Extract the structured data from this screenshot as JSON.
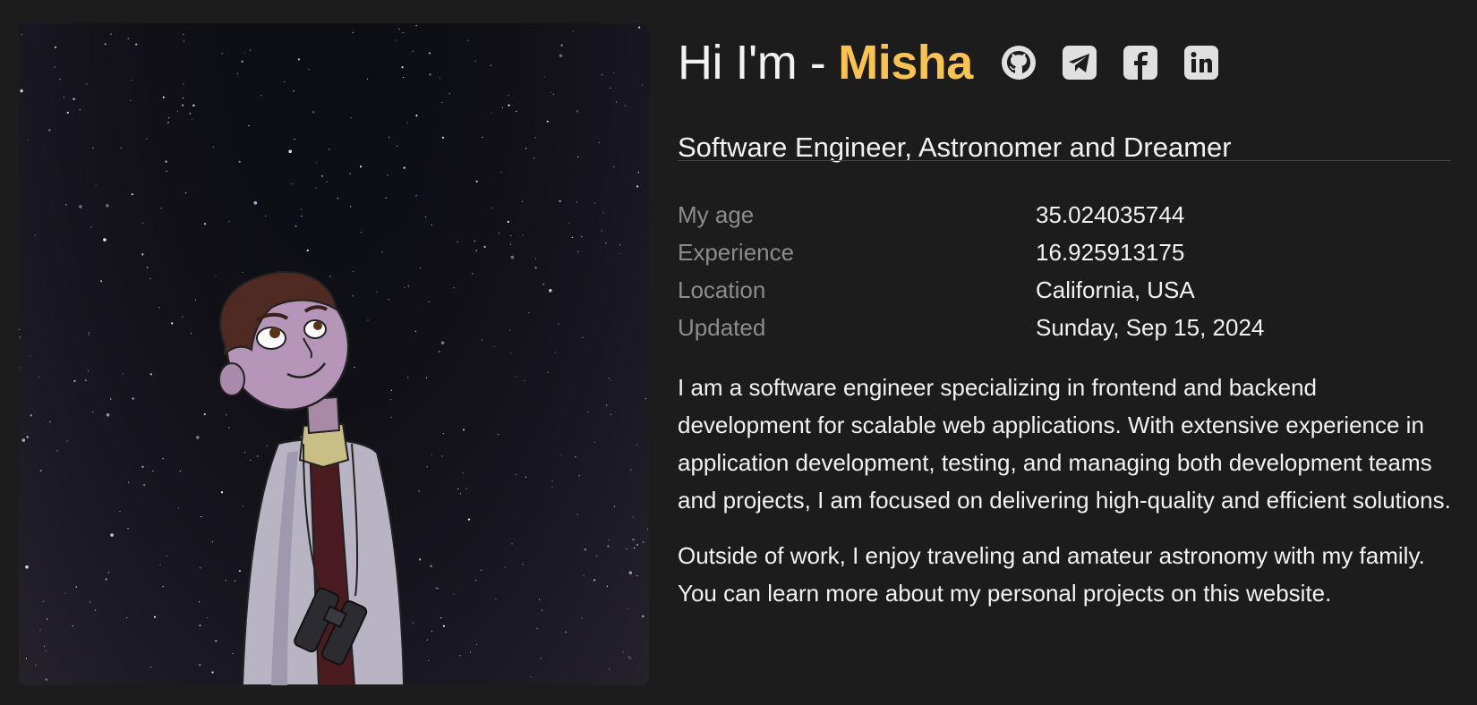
{
  "hero": {
    "greeting": "Hi I'm - ",
    "name": "Misha",
    "tagline": "Software Engineer, Astronomer and Dreamer",
    "name_color": "#fac350"
  },
  "socials": [
    {
      "icon": "github-icon",
      "label": "GitHub"
    },
    {
      "icon": "telegram-icon",
      "label": "Telegram"
    },
    {
      "icon": "facebook-icon",
      "label": "Facebook"
    },
    {
      "icon": "linkedin-icon",
      "label": "LinkedIn"
    }
  ],
  "facts": [
    {
      "label": "My age",
      "value": "35.024035744"
    },
    {
      "label": "Experience",
      "value": "16.925913175"
    },
    {
      "label": "Location",
      "value": "California, USA"
    },
    {
      "label": "Updated",
      "value": "Sunday, Sep 15, 2024"
    }
  ],
  "bio": {
    "p1": "I am a software engineer specializing in frontend and backend development for scalable web applications. With extensive experience in application development, testing, and managing both development teams and projects, I am focused on delivering high-quality and efficient solutions.",
    "p2": "Outside of work, I enjoy traveling and amateur astronomy with my family. You can learn more about my personal projects on this website."
  }
}
